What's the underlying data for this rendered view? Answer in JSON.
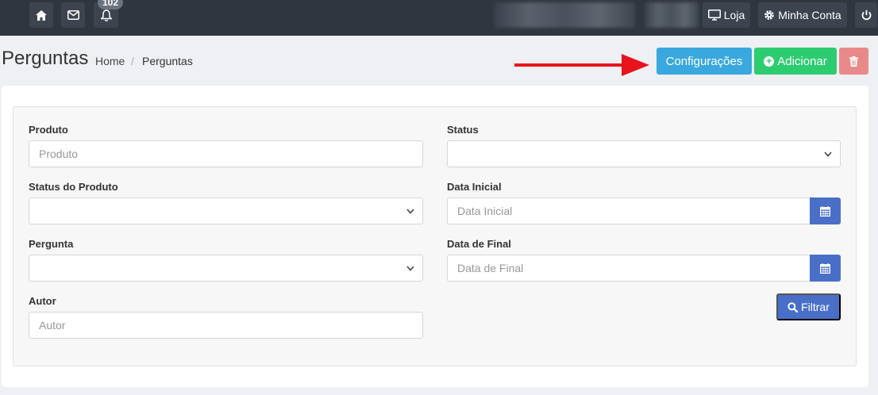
{
  "topbar": {
    "notifications_count": "102",
    "store_label": "Loja",
    "account_label": "Minha Conta"
  },
  "header": {
    "title": "Perguntas",
    "breadcrumb": {
      "home": "Home",
      "separator": "/",
      "current": "Perguntas"
    },
    "config_label": "Configurações",
    "add_label": "Adicionar"
  },
  "filters": {
    "produto": {
      "label": "Produto",
      "placeholder": "Produto"
    },
    "status": {
      "label": "Status"
    },
    "status_produto": {
      "label": "Status do Produto"
    },
    "data_inicial": {
      "label": "Data Inicial",
      "placeholder": "Data Inicial"
    },
    "pergunta": {
      "label": "Pergunta"
    },
    "data_final": {
      "label": "Data de Final",
      "placeholder": "Data de Final"
    },
    "autor": {
      "label": "Autor",
      "placeholder": "Autor"
    },
    "filter_label": "Filtrar"
  },
  "colors": {
    "topbar": "#2f3640",
    "config_button": "#3aa8df",
    "add_button": "#2ecc71",
    "delete_button": "#e88a8a",
    "primary_button": "#4a6fc8",
    "annotation_arrow": "#e8141b"
  }
}
